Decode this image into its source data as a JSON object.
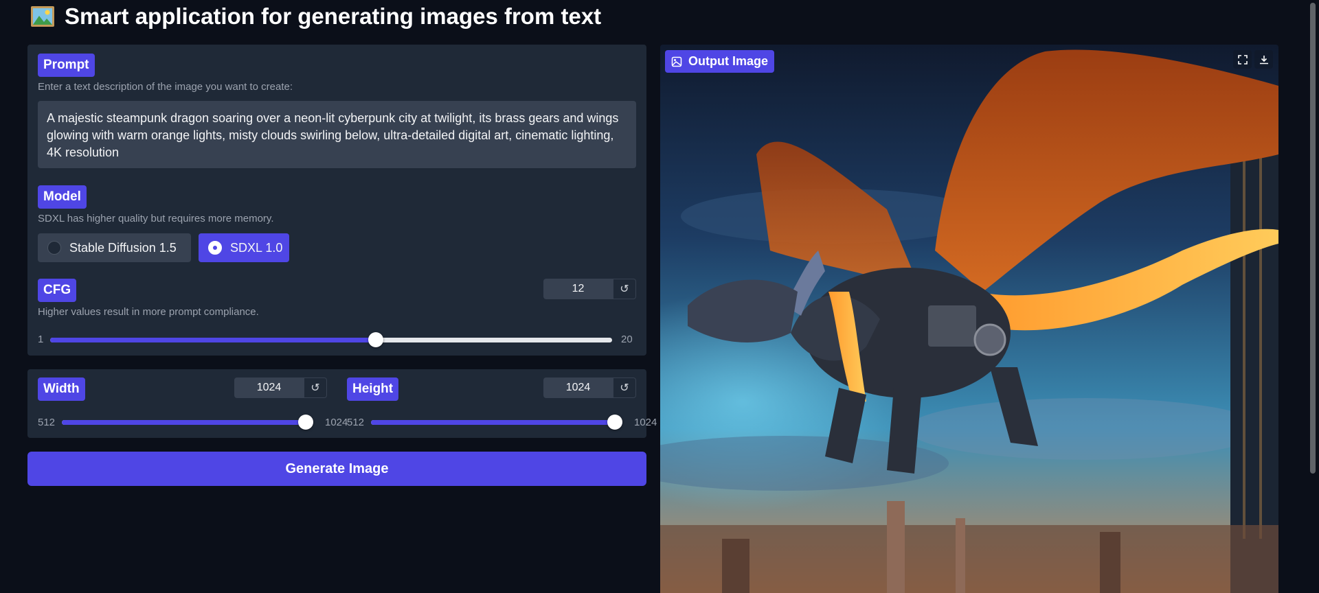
{
  "app": {
    "title": "Smart application for generating images from text",
    "title_icon": "framed-picture-icon"
  },
  "prompt": {
    "label": "Prompt",
    "hint": "Enter a text description of the image you want to create:",
    "value": "A majestic steampunk dragon soaring over a neon-lit cyberpunk city at twilight, its brass gears and wings glowing with warm orange lights, misty clouds swirling below, ultra-detailed digital art, cinematic lighting, 4K resolution"
  },
  "model": {
    "label": "Model",
    "hint": "SDXL has higher quality but requires more memory.",
    "options": [
      "Stable Diffusion 1.5",
      "SDXL 1.0"
    ],
    "selected": "SDXL 1.0"
  },
  "cfg": {
    "label": "CFG",
    "hint": "Higher values result in more prompt compliance.",
    "value": 12,
    "value_text": "12",
    "min": 1,
    "max": 20,
    "min_text": "1",
    "max_text": "20"
  },
  "width": {
    "label": "Width",
    "value": 1024,
    "value_text": "1024",
    "min": 512,
    "max": 1024,
    "min_text": "512",
    "max_text": "1024"
  },
  "height": {
    "label": "Height",
    "value": 1024,
    "value_text": "1024",
    "min": 512,
    "max": 1024,
    "min_text": "512",
    "max_text": "1024"
  },
  "generate": {
    "label": "Generate Image"
  },
  "output": {
    "label": "Output Image",
    "label_icon": "image-icon",
    "tools": [
      "fullscreen-icon",
      "download-icon"
    ]
  },
  "icons": {
    "reset": "↺",
    "reset_name": "reset-icon"
  },
  "colors": {
    "background": "#0b0f19",
    "panel": "#1f2937",
    "input": "#374151",
    "accent": "#4f46e5",
    "text": "#e5e7eb",
    "muted": "#9ca3af"
  }
}
